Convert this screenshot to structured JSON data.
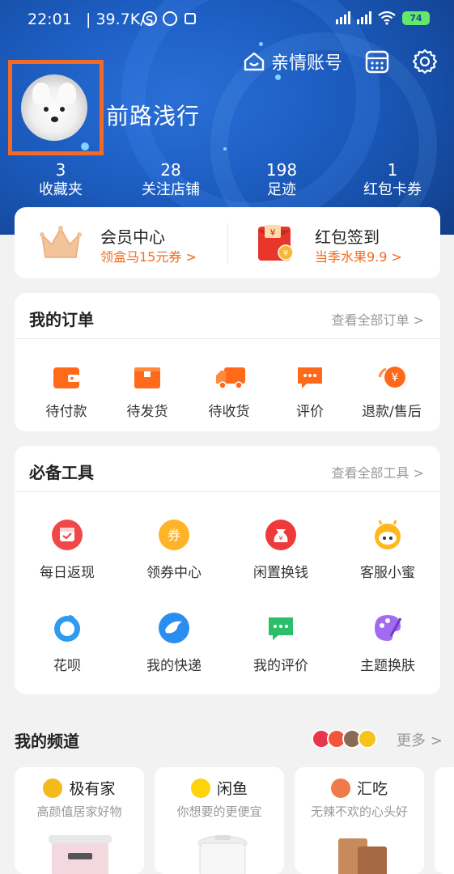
{
  "status_bar": {
    "time": "22:01",
    "network_speed": "39.7K/s",
    "battery": "74"
  },
  "header": {
    "family_account": "亲情账号",
    "username": "前路浅行",
    "stats": [
      {
        "value": "3",
        "label": "收藏夹"
      },
      {
        "value": "28",
        "label": "关注店铺"
      },
      {
        "value": "198",
        "label": "足迹"
      },
      {
        "value": "1",
        "label": "红包卡券"
      }
    ]
  },
  "vip": {
    "member": {
      "title": "会员中心",
      "subtitle": "领盒马15元券 >"
    },
    "redpacket": {
      "title": "红包签到",
      "subtitle": "当季水果9.9 >"
    }
  },
  "orders": {
    "title": "我的订单",
    "more": "查看全部订单 >",
    "items": [
      "待付款",
      "待发货",
      "待收货",
      "评价",
      "退款/售后"
    ]
  },
  "tools": {
    "title": "必备工具",
    "more": "查看全部工具 >",
    "items": [
      "每日返现",
      "领券中心",
      "闲置换钱",
      "客服小蜜",
      "花呗",
      "我的快递",
      "我的评价",
      "主题换肤"
    ]
  },
  "channels": {
    "title": "我的频道",
    "more": "更多 >",
    "cards": [
      {
        "name": "极有家",
        "subtitle": "高颜值居家好物"
      },
      {
        "name": "闲鱼",
        "subtitle": "你想要的更便宜"
      },
      {
        "name": "汇吃",
        "subtitle": "无辣不欢的心头好"
      }
    ]
  },
  "colors": {
    "header_blue": "#1e5fc4",
    "accent_orange": "#f26b1d",
    "highlight_box": "#f26a23"
  }
}
